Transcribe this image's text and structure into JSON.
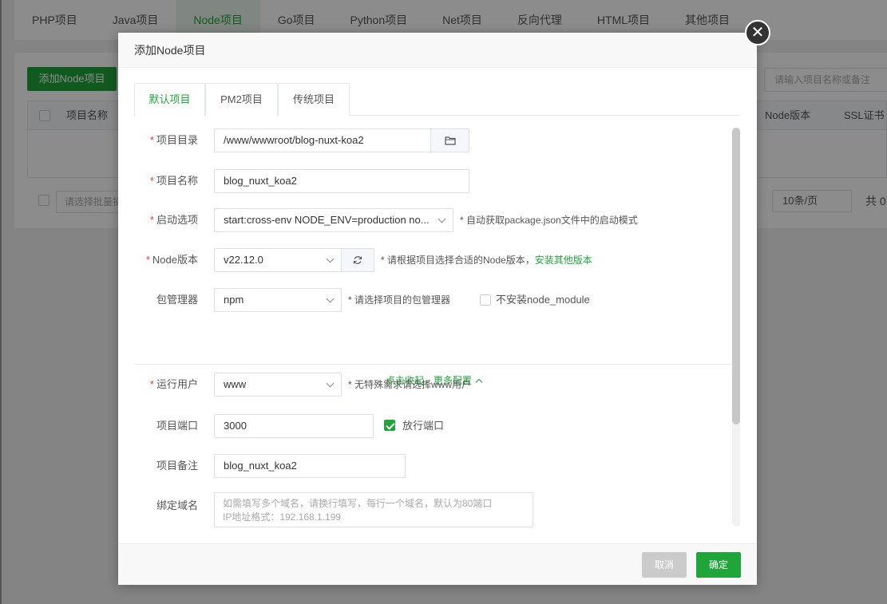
{
  "background": {
    "tabs": [
      "PHP项目",
      "Java项目",
      "Node项目",
      "Go项目",
      "Python项目",
      "Net项目",
      "反向代理",
      "HTML项目",
      "其他项目"
    ],
    "active_tab": "Node项目",
    "add_button": "添加Node项目",
    "search_placeholder": "请输入项目名称或备注",
    "columns": {
      "name": "项目名称",
      "node_version": "Node版本",
      "ssl": "SSL证书"
    },
    "batch_placeholder": "请选择批量操作",
    "page_size": "10条/页",
    "total_prefix": "共 0"
  },
  "dialog": {
    "title": "添加Node项目",
    "tabs": [
      "默认项目",
      "PM2项目",
      "传统项目"
    ],
    "active_tab": "默认项目",
    "fields": {
      "project_dir": {
        "label": "项目目录",
        "value": "/www/wwwroot/blog-nuxt-koa2"
      },
      "project_name": {
        "label": "项目名称",
        "value": "blog_nuxt_koa2"
      },
      "start_option": {
        "label": "启动选项",
        "value": "start:cross-env NODE_ENV=production no...",
        "hint": "* 自动获取package.json文件中的启动模式"
      },
      "node_version": {
        "label": "Node版本",
        "value": "v22.12.0",
        "hint": "* 请根据项目选择合适的Node版本，",
        "link": "安装其他版本"
      },
      "package_manager": {
        "label": "包管理器",
        "value": "npm",
        "hint": "* 请选择项目的包管理器",
        "checkbox_label": "不安装node_module"
      },
      "run_user": {
        "label": "运行用户",
        "value": "www",
        "hint": "* 无特殊需求请选择www用户"
      },
      "port": {
        "label": "项目端口",
        "value": "3000",
        "checkbox_label": "放行端口"
      },
      "remark": {
        "label": "项目备注",
        "value": "blog_nuxt_koa2"
      },
      "domain": {
        "label": "绑定域名",
        "placeholder_line1": "如需填写多个域名，请换行填写，每行一个域名，默认为80端口",
        "placeholder_line2": "IP地址格式：192.168.1.199"
      }
    },
    "collapse_text": "点击收起，更多配置",
    "cancel_label": "取消",
    "ok_label": "确定"
  },
  "colors": {
    "accent": "#20a53a",
    "required": "#e53935"
  }
}
